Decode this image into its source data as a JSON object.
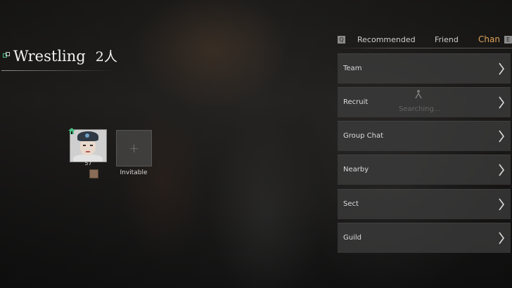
{
  "party": {
    "title": "Wrestling",
    "count": "2人",
    "member": {
      "level": "57"
    },
    "invite_label": "Invitable",
    "invite_plus": "+"
  },
  "tabs": {
    "left_key": "Q",
    "recommended": "Recommended",
    "friend": "Friend",
    "channel": "Chan",
    "right_key": "E"
  },
  "menu": {
    "items": [
      {
        "label": "Team"
      },
      {
        "label": "Recruit"
      },
      {
        "label": "Group Chat"
      },
      {
        "label": "Nearby"
      },
      {
        "label": "Sect"
      },
      {
        "label": "Guild"
      }
    ]
  },
  "overlay": {
    "text": "Searching..."
  },
  "colors": {
    "accent": "#e0a35a",
    "leader": "#4fbf86",
    "panel": "#3e3e3e"
  },
  "icons": [
    "team-icon",
    "leader-icon",
    "chevron-right-icon",
    "add-icon",
    "figure-icon"
  ]
}
